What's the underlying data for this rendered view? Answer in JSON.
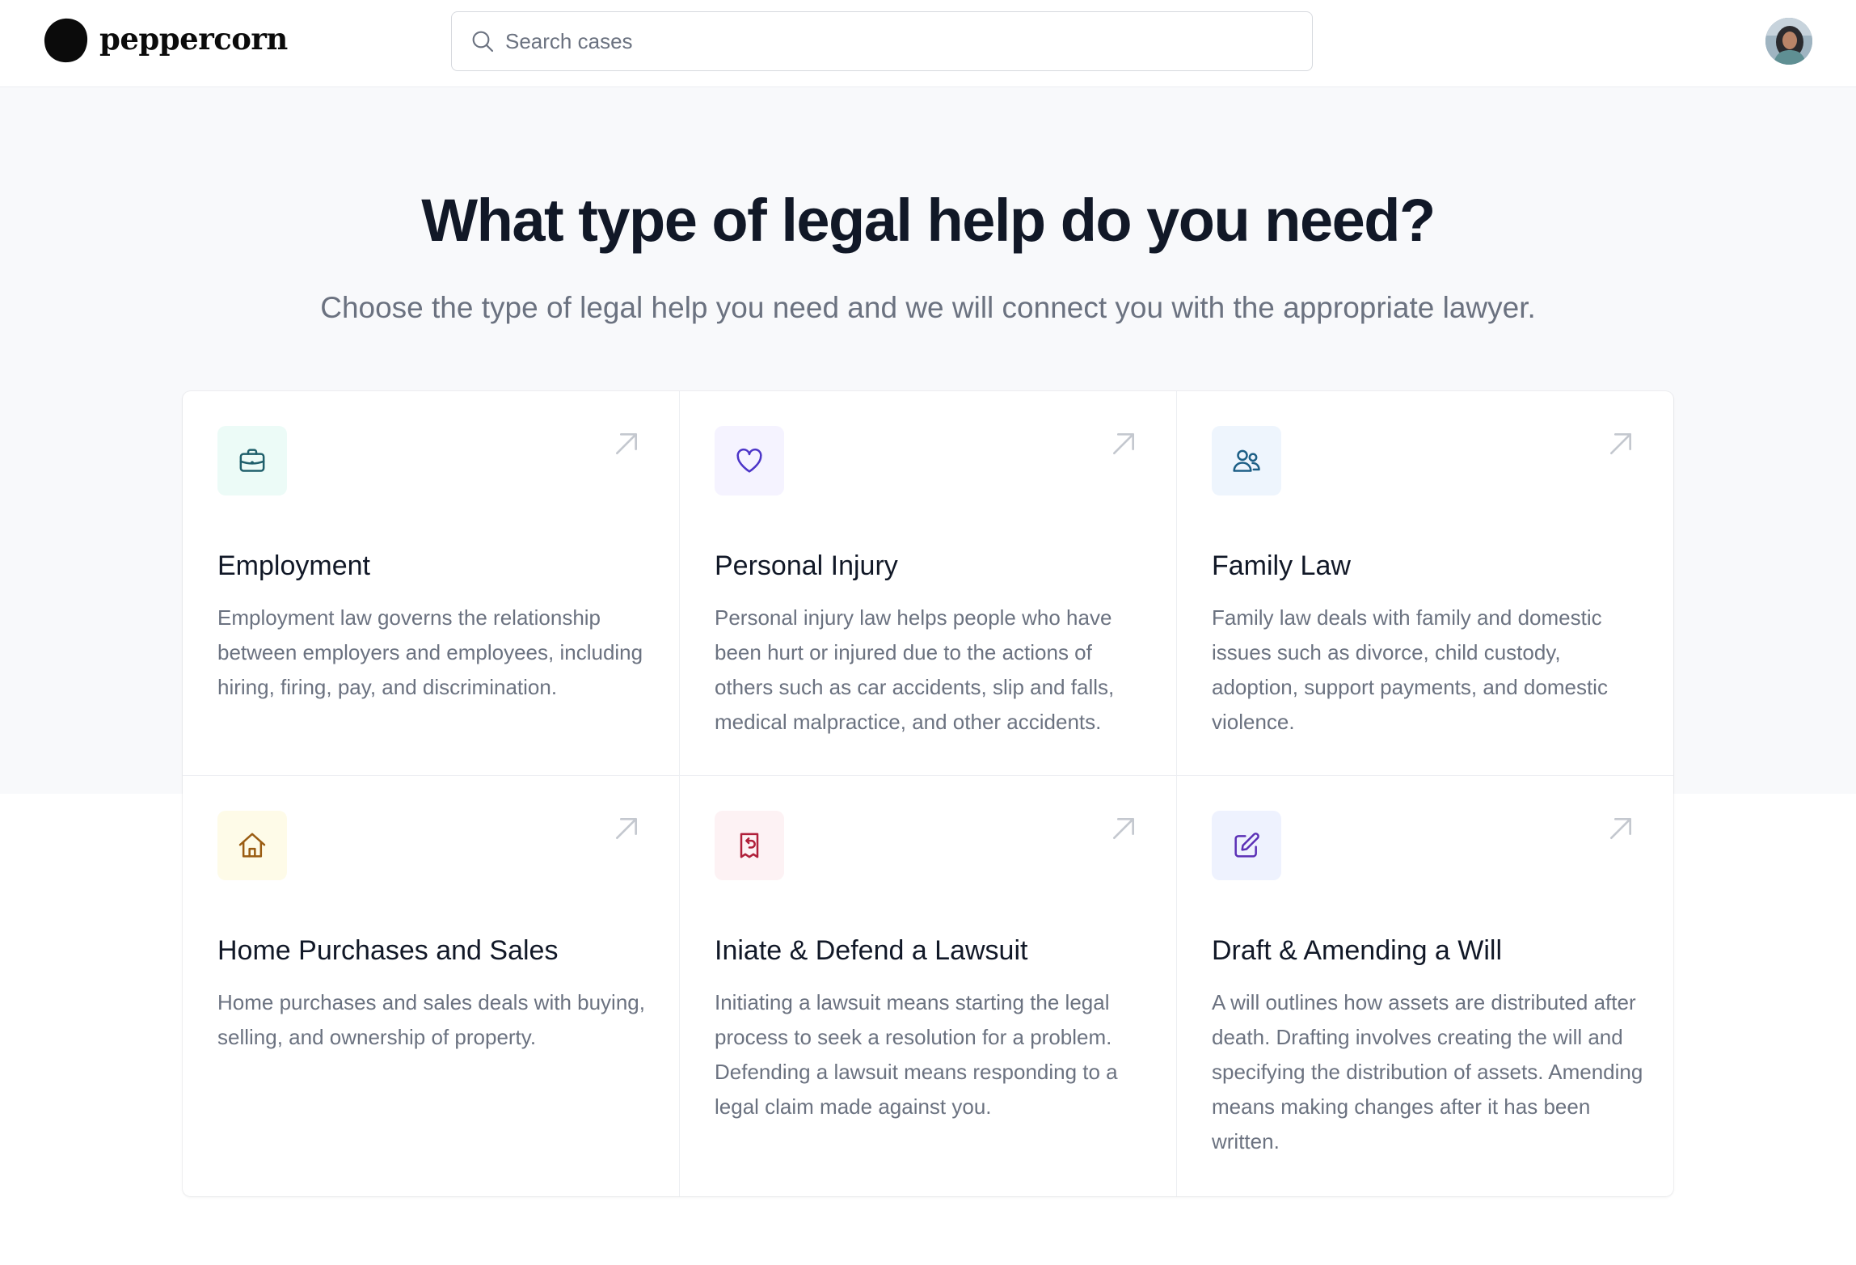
{
  "header": {
    "brand": "peppercorn",
    "search_placeholder": "Search cases"
  },
  "hero": {
    "title": "What type of legal help do you need?",
    "subtitle": "Choose the type of legal help you need and we will connect you with the appropriate lawyer."
  },
  "cards": [
    {
      "title": "Employment",
      "description": "Employment law governs the relationship between employers and employees, including hiring, firing, pay, and discrimination.",
      "icon": "briefcase-icon",
      "icon_color": "#1f5f6b",
      "icon_bg": "#ecfbf7"
    },
    {
      "title": "Personal Injury",
      "description": "Personal injury law helps people who have been hurt or injured due to the actions of others such as car accidents, slip and falls, medical malpractice, and other accidents.",
      "icon": "heart-icon",
      "icon_color": "#4c35c8",
      "icon_bg": "#f5f3ff"
    },
    {
      "title": "Family Law",
      "description": "Family law deals with family and domestic issues such as divorce, child custody, adoption, support payments, and domestic violence.",
      "icon": "users-icon",
      "icon_color": "#1d5f86",
      "icon_bg": "#eef5fd"
    },
    {
      "title": "Home Purchases and Sales",
      "description": "Home purchases and sales deals with buying, selling, and ownership of property.",
      "icon": "home-icon",
      "icon_color": "#9a5c12",
      "icon_bg": "#fefbe8"
    },
    {
      "title": "Iniate & Defend a Lawsuit",
      "description": "Initiating a lawsuit means starting the legal process to seek a resolution for a problem. Defending a lawsuit means responding to a legal claim made against you.",
      "icon": "receipt-refund-icon",
      "icon_color": "#b0203a",
      "icon_bg": "#fdf2f4"
    },
    {
      "title": "Draft & Amending a Will",
      "description": "A will outlines how assets are distributed after death. Drafting involves creating the will and specifying the distribution of assets. Amending means making changes after it has been written.",
      "icon": "pencil-square-icon",
      "icon_color": "#5b30b6",
      "icon_bg": "#eef2fe"
    }
  ]
}
